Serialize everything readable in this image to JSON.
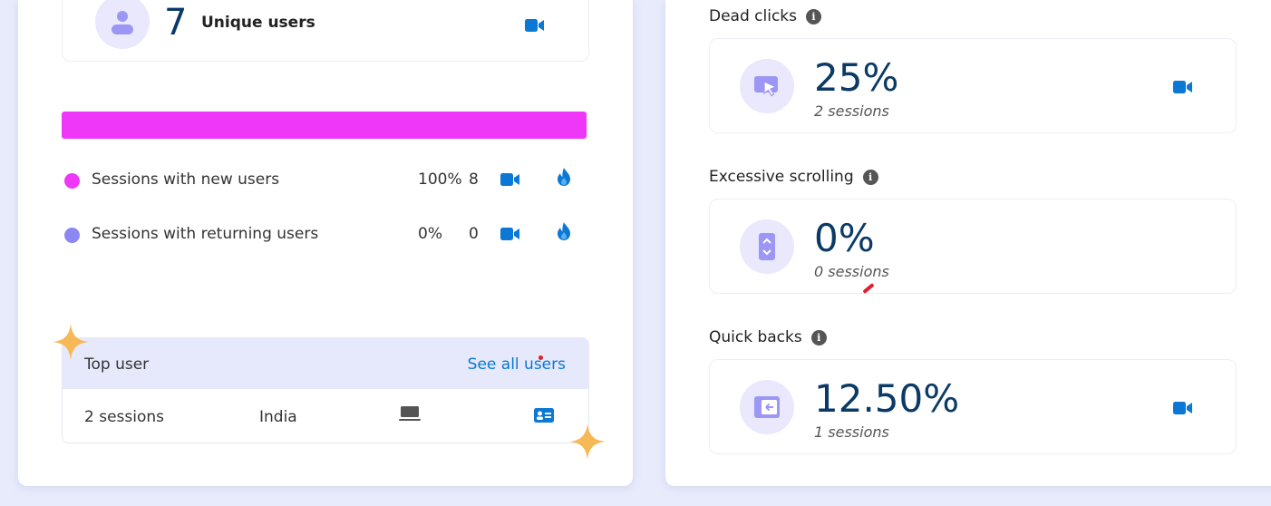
{
  "users": {
    "count": "7",
    "label": "Unique users"
  },
  "sessions_breakdown": {
    "bar_color": "#ee37f8",
    "rows": [
      {
        "label": "Sessions with new users",
        "percent": "100%",
        "count": "8",
        "dot_color": "#ee37f8"
      },
      {
        "label": "Sessions with returning users",
        "percent": "0%",
        "count": "0",
        "dot_color": "#8c87f2"
      }
    ]
  },
  "top_user": {
    "title": "Top user",
    "see_all": "See all users",
    "sessions": "2 sessions",
    "country": "India"
  },
  "metrics": [
    {
      "title": "Dead clicks",
      "value": "25%",
      "sessions": "2 sessions",
      "icon": "dead-click-icon"
    },
    {
      "title": "Excessive scrolling",
      "value": "0%",
      "sessions": "0 sessions",
      "icon": "scroll-icon"
    },
    {
      "title": "Quick backs",
      "value": "12.50%",
      "sessions": "1 sessions",
      "icon": "quick-back-icon"
    }
  ],
  "colors": {
    "accent_blue": "#0a78d4",
    "number_navy": "#0b3a66",
    "icon_purple": "#9c97f5",
    "icon_bg": "#e9e8fd",
    "sparkle": "#f7b955"
  }
}
